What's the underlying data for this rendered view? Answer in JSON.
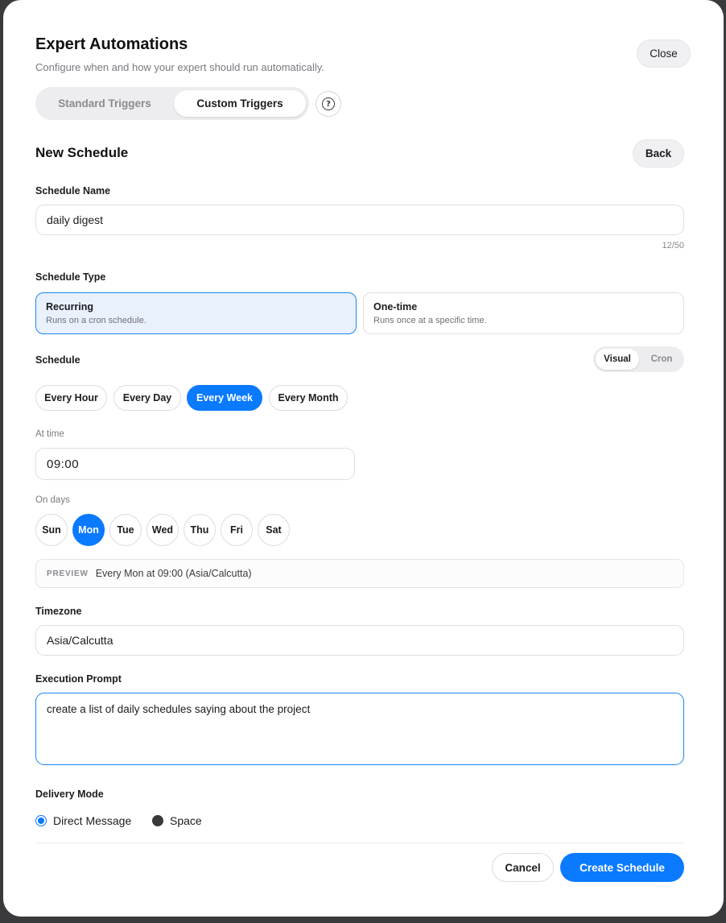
{
  "header": {
    "title": "Expert Automations",
    "subtitle": "Configure when and how your expert should run automatically.",
    "close_label": "Close"
  },
  "trigger_tabs": {
    "standard": "Standard Triggers",
    "custom": "Custom Triggers",
    "help_glyph": "?"
  },
  "form": {
    "heading": "New Schedule",
    "back_label": "Back",
    "name_label": "Schedule Name",
    "name_value": "daily digest",
    "name_counter": "12/50",
    "type_label": "Schedule Type",
    "types": [
      {
        "title": "Recurring",
        "desc": "Runs on a cron schedule.",
        "selected": true
      },
      {
        "title": "One-time",
        "desc": "Runs once at a specific time.",
        "selected": false
      }
    ],
    "schedule_label": "Schedule",
    "mode_toggle": {
      "visual": "Visual",
      "cron": "Cron",
      "selected": "Visual"
    },
    "frequencies": [
      "Every Hour",
      "Every Day",
      "Every Week",
      "Every Month"
    ],
    "selected_frequency": "Every Week",
    "at_time_label": "At time",
    "time_value": "09:00",
    "on_days_label": "On days",
    "days": [
      "Sun",
      "Mon",
      "Tue",
      "Wed",
      "Thu",
      "Fri",
      "Sat"
    ],
    "selected_day": "Mon",
    "preview_key": "PREVIEW",
    "preview_text": "Every Mon at 09:00 (Asia/Calcutta)",
    "timezone_label": "Timezone",
    "timezone_value": "Asia/Calcutta",
    "prompt_label": "Execution Prompt",
    "prompt_value": "create a list of daily schedules saying about the project",
    "delivery_label": "Delivery Mode",
    "delivery_options": [
      "Direct Message",
      "Space"
    ],
    "selected_delivery": "Direct Message",
    "cancel_label": "Cancel",
    "create_label": "Create Schedule"
  },
  "colors": {
    "accent": "#0a7aff",
    "selected_card_bg": "#e9f1fd",
    "backdrop": "#3a3a3c"
  }
}
